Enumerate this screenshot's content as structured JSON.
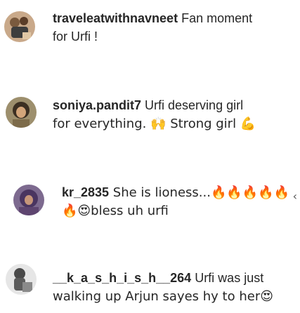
{
  "comments": [
    {
      "username": "traveleatwithnavneet",
      "text_line1": " Fan moment",
      "text_line2": "for Urfi !"
    },
    {
      "username": "soniya.pandit7",
      "text_line1": " Urfi deserving girl",
      "text_line2": "for everything. 🙌 Strong girl 💪"
    },
    {
      "username": "kr_2835",
      "text_line1": " She is lioness...🔥🔥🔥🔥🔥",
      "text_line2": "🔥😍bless uh urfi"
    },
    {
      "username": "__k_a_s_h_i_s_h__264",
      "text_line1": " Urfi was just",
      "text_line2": "walking up Arjun sayes hy to her😍"
    }
  ],
  "nav": {
    "next_glyph": "‹"
  },
  "icons": {
    "avatar1": "user-avatar-icon",
    "avatar2": "user-avatar-icon",
    "avatar3": "user-avatar-icon",
    "avatar4": "user-avatar-icon",
    "chevron": "chevron-left-icon"
  }
}
